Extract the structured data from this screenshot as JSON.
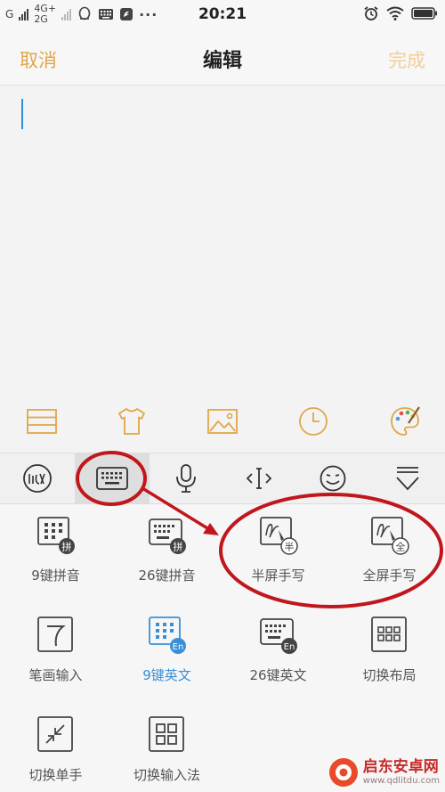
{
  "status_bar": {
    "carrier1": "G",
    "net_top": "4G+",
    "net_bottom": "2G",
    "more": "···",
    "time": "20:21",
    "battery": "battery-icon"
  },
  "nav": {
    "cancel": "取消",
    "title": "编辑",
    "done": "完成"
  },
  "format_bar": {
    "icons": [
      "list-lines-icon",
      "tshirt-icon",
      "image-icon",
      "clock-icon",
      "palette-icon"
    ],
    "color": "#e0a64a"
  },
  "keyboard_toolbar": {
    "logo": "iflytek-logo-icon",
    "items": [
      "keyboard-icon",
      "microphone-icon",
      "cursor-icon",
      "emoji-icon",
      "hide-keyboard-icon"
    ],
    "active": "keyboard-icon"
  },
  "keyboard_modes": [
    {
      "label": "9键拼音",
      "icon": "keypad-9-pinyin-icon",
      "highlight": false
    },
    {
      "label": "26键拼音",
      "icon": "keypad-26-pinyin-icon",
      "highlight": false
    },
    {
      "label": "半屏手写",
      "icon": "half-screen-handwriting-icon",
      "highlight": false
    },
    {
      "label": "全屏手写",
      "icon": "full-screen-handwriting-icon",
      "highlight": false
    },
    {
      "label": "笔画输入",
      "icon": "stroke-input-icon",
      "highlight": false
    },
    {
      "label": "9键英文",
      "icon": "keypad-9-english-icon",
      "highlight": true
    },
    {
      "label": "26键英文",
      "icon": "keypad-26-english-icon",
      "highlight": false
    },
    {
      "label": "切换布局",
      "icon": "switch-layout-icon",
      "highlight": false
    },
    {
      "label": "切换单手",
      "icon": "one-hand-mode-icon",
      "highlight": false
    },
    {
      "label": "切换输入法",
      "icon": "switch-input-method-icon",
      "highlight": false
    }
  ],
  "icon_badges": {
    "pinyin": "拼",
    "half": "半",
    "full": "全",
    "english": "En"
  },
  "watermark": {
    "name": "启东安卓网",
    "url": "www.qdlitdu.com"
  },
  "colors": {
    "accent": "#e0a64a",
    "accent_disabled": "#f2cf96",
    "highlight_blue": "#3a8fd6",
    "annotation_red": "#c0161c"
  }
}
